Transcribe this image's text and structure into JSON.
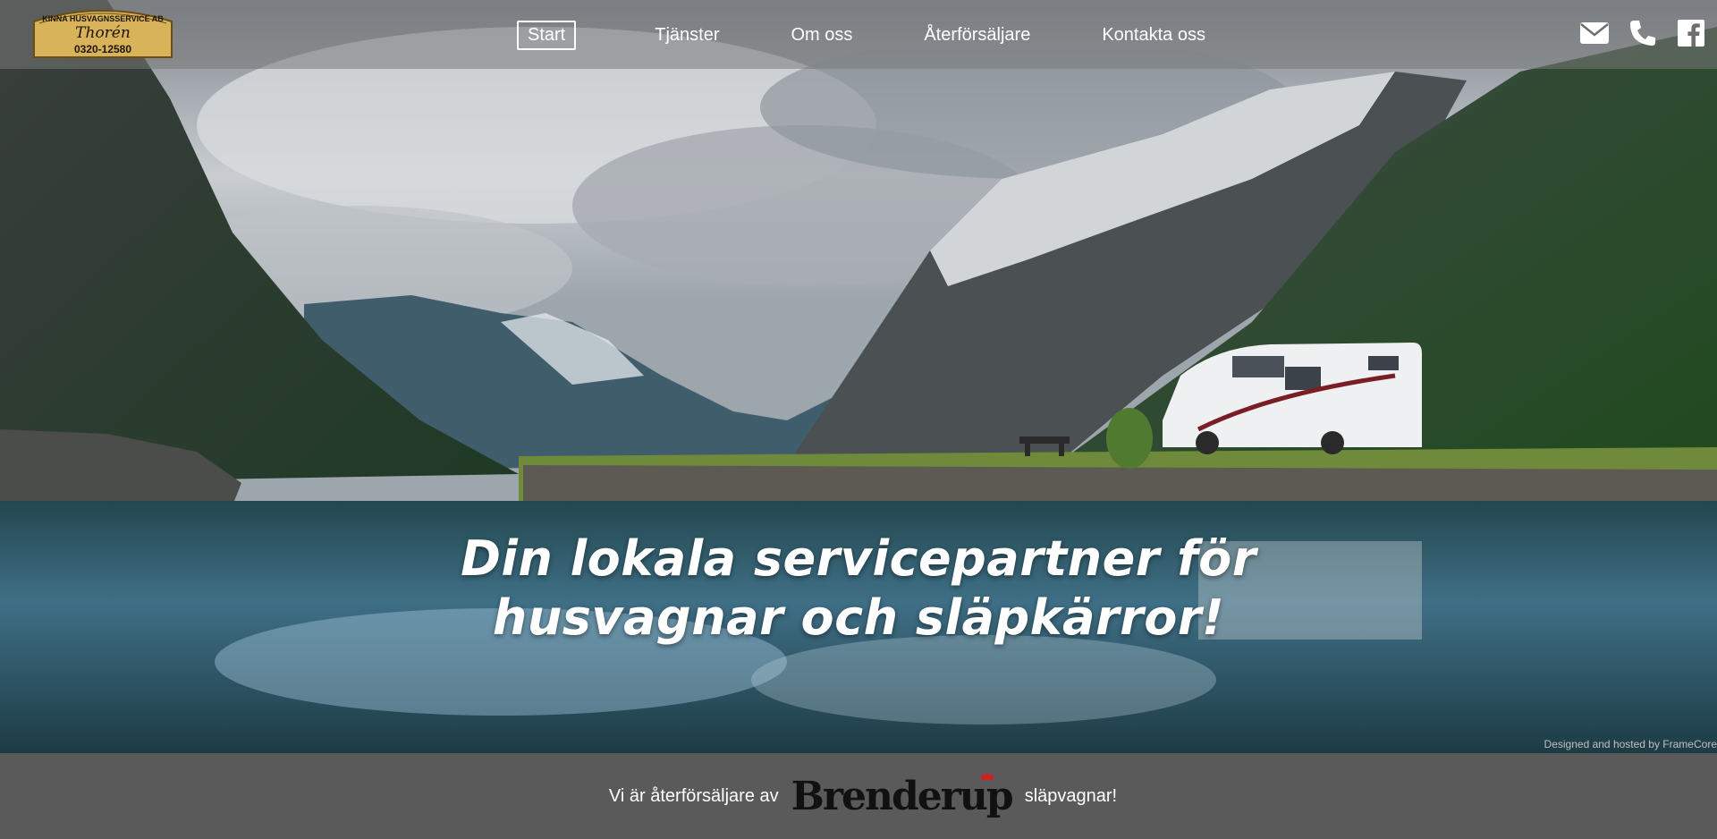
{
  "logo": {
    "line1": "KINNA HUSVAGNSSERVICE AB",
    "line2": "Thorén",
    "line3": "0320-12580"
  },
  "nav": {
    "items": [
      {
        "label": "Start",
        "active": true
      },
      {
        "label": "Tjänster",
        "active": false
      },
      {
        "label": "Om oss",
        "active": false
      },
      {
        "label": "Återförsäljare",
        "active": false
      },
      {
        "label": "Kontakta oss",
        "active": false
      }
    ]
  },
  "social": {
    "icons": [
      "envelope-icon",
      "phone-icon",
      "facebook-icon"
    ]
  },
  "hero": {
    "headline_line1": "Din lokala servicepartner för",
    "headline_line2": "husvagnar och släpkärror!",
    "credit": "Designed and hosted by FrameCore"
  },
  "footer": {
    "text_before": "Vi är återförsäljare av",
    "brand": "Brenderup",
    "text_after": "släpvagnar!"
  },
  "colors": {
    "footer_bg": "#5a5a5a",
    "nav_overlay": "rgba(120,120,120,0.55)",
    "logo_gold": "#d9b35a",
    "brand_accent": "#d21f1f"
  }
}
